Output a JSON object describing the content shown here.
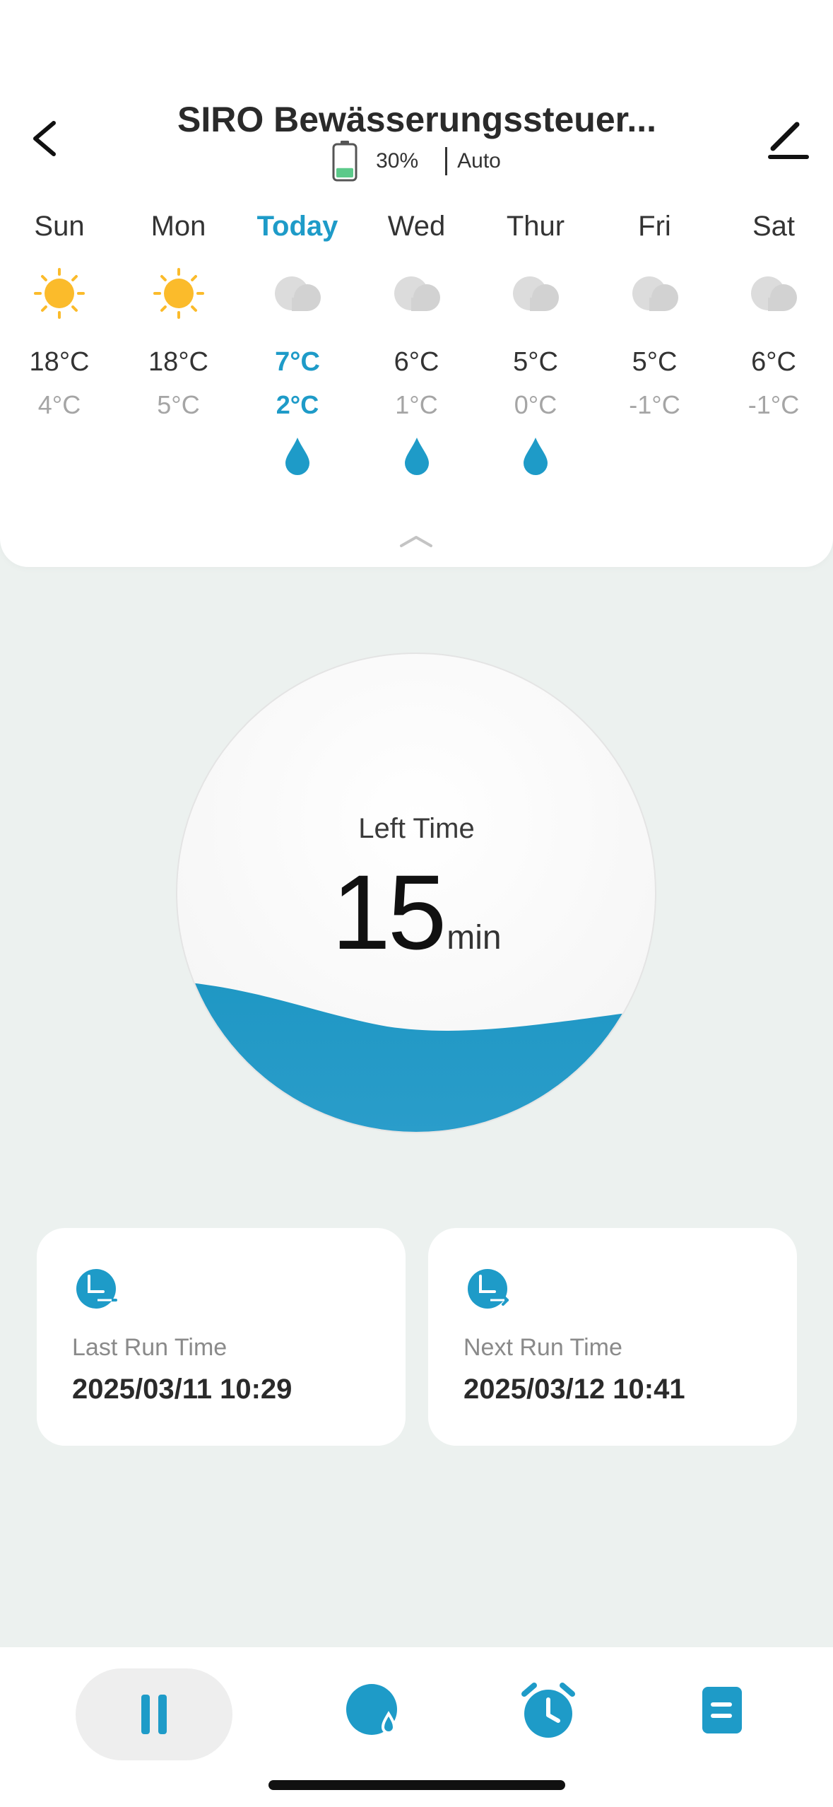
{
  "header": {
    "title": "SIRO Bewässerungssteuer...",
    "battery_percent": "30%",
    "battery_level": 0.3,
    "mode": "Auto"
  },
  "forecast": [
    {
      "day": "Sun",
      "icon": "sun-icon",
      "high": "18°C",
      "low": "4°C",
      "rain": false
    },
    {
      "day": "Mon",
      "icon": "sun-icon",
      "high": "18°C",
      "low": "5°C",
      "rain": false
    },
    {
      "day": "Today",
      "icon": "cloud-icon",
      "high": "7°C",
      "low": "2°C",
      "rain": true
    },
    {
      "day": "Wed",
      "icon": "cloud-icon",
      "high": "6°C",
      "low": "1°C",
      "rain": true
    },
    {
      "day": "Thur",
      "icon": "cloud-icon",
      "high": "5°C",
      "low": "0°C",
      "rain": true
    },
    {
      "day": "Fri",
      "icon": "cloud-icon",
      "high": "5°C",
      "low": "-1°C",
      "rain": false
    },
    {
      "day": "Sat",
      "icon": "cloud-icon",
      "high": "6°C",
      "low": "-1°C",
      "rain": false
    }
  ],
  "gauge": {
    "label": "Left Time",
    "value": "15",
    "unit": "min"
  },
  "last_run": {
    "label": "Last Run Time",
    "value": "2025/03/11 10:29"
  },
  "next_run": {
    "label": "Next Run Time",
    "value": "2025/03/12 10:41"
  },
  "colors": {
    "accent": "#1e9bc8",
    "sun": "#fbbb2b",
    "cloud": "#dcdcdc",
    "background": "#ecf1ef",
    "battery_fill": "#5cc98a"
  },
  "nav": [
    "pause-icon",
    "water-drop-icon",
    "alarm-clock-icon",
    "log-list-icon"
  ]
}
